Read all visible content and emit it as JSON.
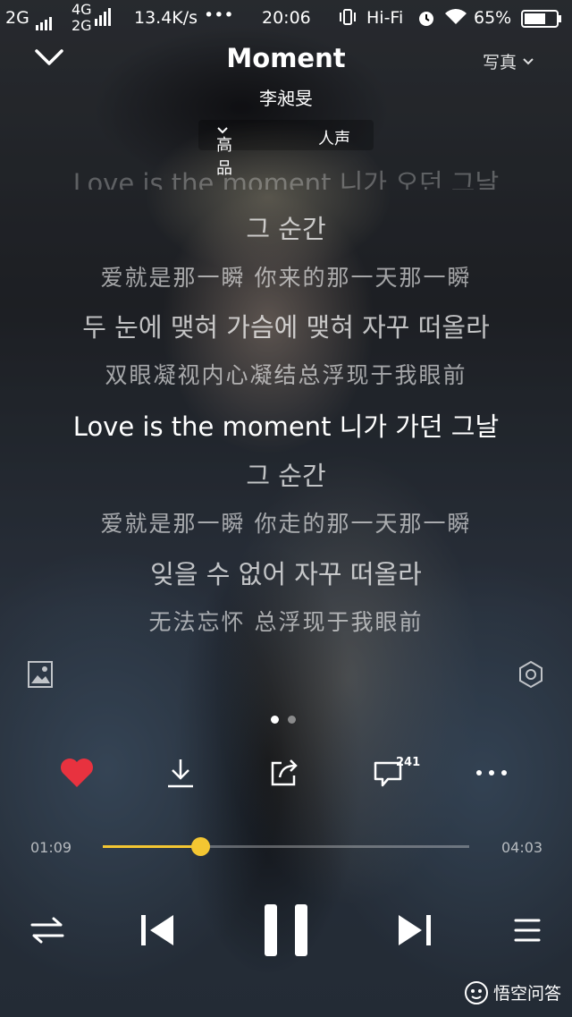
{
  "status_bar": {
    "net1": "2G",
    "net2_top": "4G",
    "net2_bottom": "2G",
    "speed": "13.4K/s",
    "more": "•••",
    "time": "20:06",
    "hifi": "Hi-Fi",
    "battery": "65%"
  },
  "header": {
    "title": "Moment",
    "artist": "李昶旻",
    "photo_label": "写真",
    "quality_label": "高品",
    "vocal_label": "人声"
  },
  "lyrics": [
    {
      "text": "Love is the moment 니가 오던 그날",
      "type": "ko"
    },
    {
      "text": "그 순간",
      "type": "ko"
    },
    {
      "text": "爱就是那一瞬 你来的那一天那一瞬",
      "type": "zh"
    },
    {
      "text": "두 눈에 맺혀 가슴에 맺혀 자꾸 떠올라",
      "type": "ko"
    },
    {
      "text": "双眼凝视内心凝结总浮现于我眼前",
      "type": "zh"
    },
    {
      "text": "Love is the moment 니가 가던 그날",
      "type": "current"
    },
    {
      "text": "그 순간",
      "type": "ko"
    },
    {
      "text": "爱就是那一瞬 你走的那一天那一瞬",
      "type": "zh"
    },
    {
      "text": "잊을 수 없어 자꾸 떠올라",
      "type": "ko"
    },
    {
      "text": "无法忘怀 总浮现于我眼前",
      "type": "zh"
    }
  ],
  "actions": {
    "like_color": "#e8323f",
    "comment_count": "241"
  },
  "progress": {
    "elapsed": "01:09",
    "total": "04:03",
    "fraction": 0.265,
    "accent": "#f3c632"
  },
  "icons": [
    "chevron-down-icon",
    "image-icon",
    "settings-hexagon-icon",
    "heart-icon",
    "download-icon",
    "share-icon",
    "comment-icon",
    "more-icon",
    "repeat-icon",
    "previous-icon",
    "pause-icon",
    "next-icon",
    "playlist-icon"
  ],
  "watermark": "悟空问答"
}
